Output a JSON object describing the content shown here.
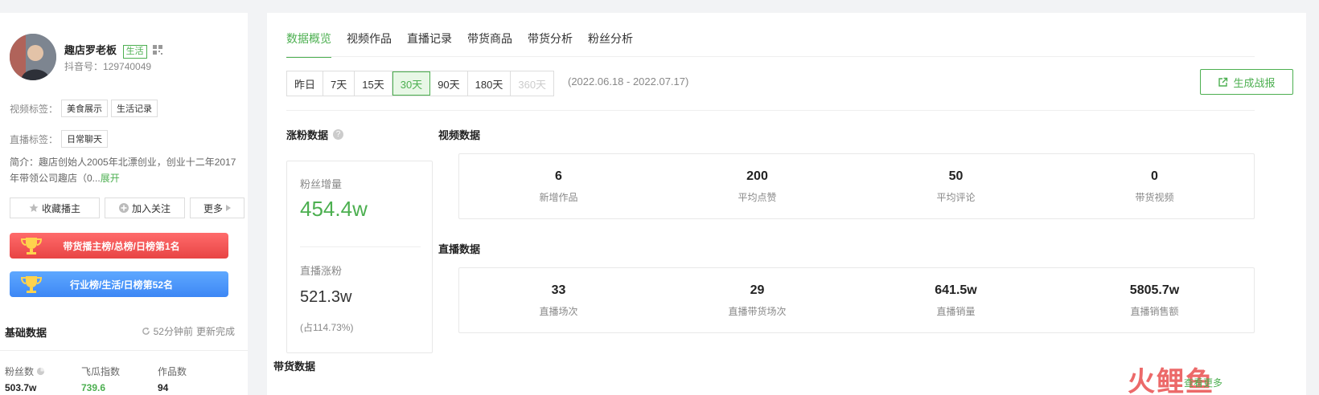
{
  "profile": {
    "name": "趣店罗老板",
    "category_tag": "生活",
    "douyin_id": "抖音号：129740049",
    "video_tags_label": "视频标签：",
    "video_tags": [
      "美食展示",
      "生活记录"
    ],
    "live_tags_label": "直播标签：",
    "live_tags": [
      "日常聊天"
    ],
    "intro": "简介：趣店创始人2005年北漂创业，创业十二年2017年带领公司趣店（0...",
    "intro_more": "展开",
    "buttons": {
      "collect": "收藏播主",
      "follow": "加入关注",
      "more": "更多"
    },
    "rank_sales": "带货播主榜/总榜/日榜第1名",
    "rank_industry": "行业榜/生活/日榜第52名",
    "basic_title": "基础数据",
    "update_time": "52分钟前",
    "update_status": "更新完成",
    "stats": [
      {
        "label": "粉丝数",
        "value": "503.7w"
      },
      {
        "label": "飞瓜指数",
        "value": "739.6"
      },
      {
        "label": "作品数",
        "value": "94"
      }
    ]
  },
  "tabs": [
    "数据概览",
    "视频作品",
    "直播记录",
    "带货商品",
    "带货分析",
    "粉丝分析"
  ],
  "periods": [
    "昨日",
    "7天",
    "15天",
    "30天",
    "90天",
    "180天",
    "360天"
  ],
  "date_range": "(2022.06.18 - 2022.07.17)",
  "generate_report": "生成战报",
  "fans_section": {
    "title": "涨粉数据",
    "growth_label": "粉丝增量",
    "growth_value": "454.4w",
    "live_label": "直播涨粉",
    "live_value": "521.3w",
    "live_pct": "(占114.73%)"
  },
  "video_section": {
    "title": "视频数据",
    "items": [
      {
        "value": "6",
        "label": "新增作品"
      },
      {
        "value": "200",
        "label": "平均点赞"
      },
      {
        "value": "50",
        "label": "平均评论"
      },
      {
        "value": "0",
        "label": "带货视频"
      }
    ]
  },
  "live_section": {
    "title": "直播数据",
    "items": [
      {
        "value": "33",
        "label": "直播场次"
      },
      {
        "value": "29",
        "label": "直播带货场次"
      },
      {
        "value": "641.5w",
        "label": "直播销量"
      },
      {
        "value": "5805.7w",
        "label": "直播销售额"
      }
    ]
  },
  "goods_section": {
    "title": "带货数据",
    "more": "查看更多"
  },
  "watermark": "火鲤鱼",
  "colors": {
    "accent": "#4caf50",
    "rank_red": "#e84444",
    "rank_blue": "#3d87f5"
  }
}
